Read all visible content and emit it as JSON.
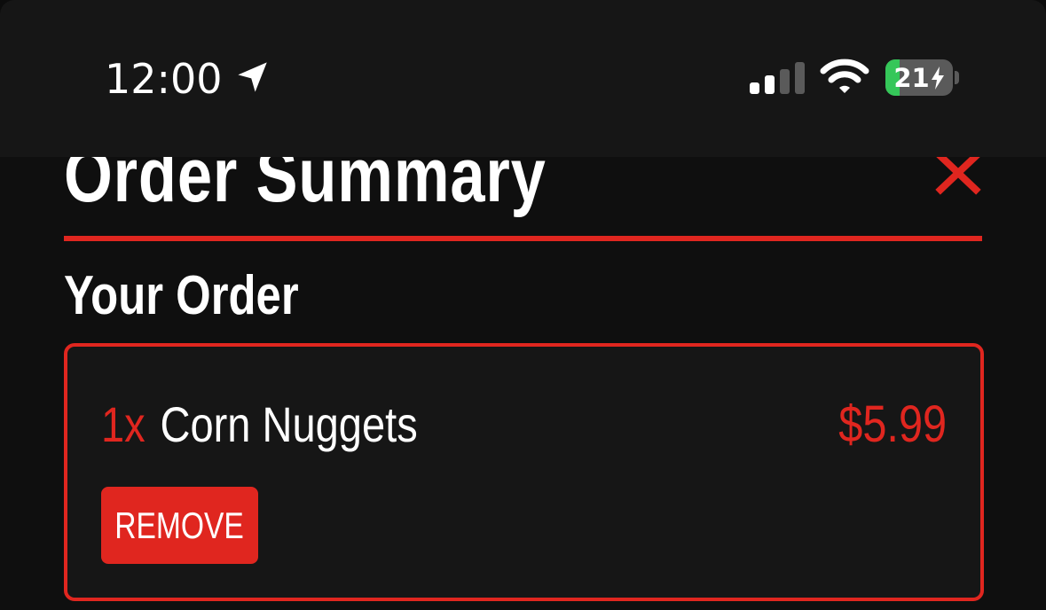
{
  "status_bar": {
    "time": "12:00",
    "battery_level": 21,
    "battery_text": "21",
    "icons": [
      "location-arrow-icon",
      "cellular-signal-icon",
      "wifi-icon",
      "battery-charging-icon"
    ]
  },
  "header": {
    "title": "Order Summary",
    "close_icon": "close-x-icon"
  },
  "order": {
    "heading": "Your Order",
    "items": [
      {
        "quantity": "1x",
        "name": "Corn Nuggets",
        "price": "$5.99",
        "remove_label": "REMOVE"
      }
    ]
  },
  "colors": {
    "accent": "#e0261f",
    "background": "#0f0f0f",
    "status_bar_background": "#161616",
    "card_background": "#161616",
    "text": "#ffffff",
    "battery_fill": "#35c759"
  }
}
